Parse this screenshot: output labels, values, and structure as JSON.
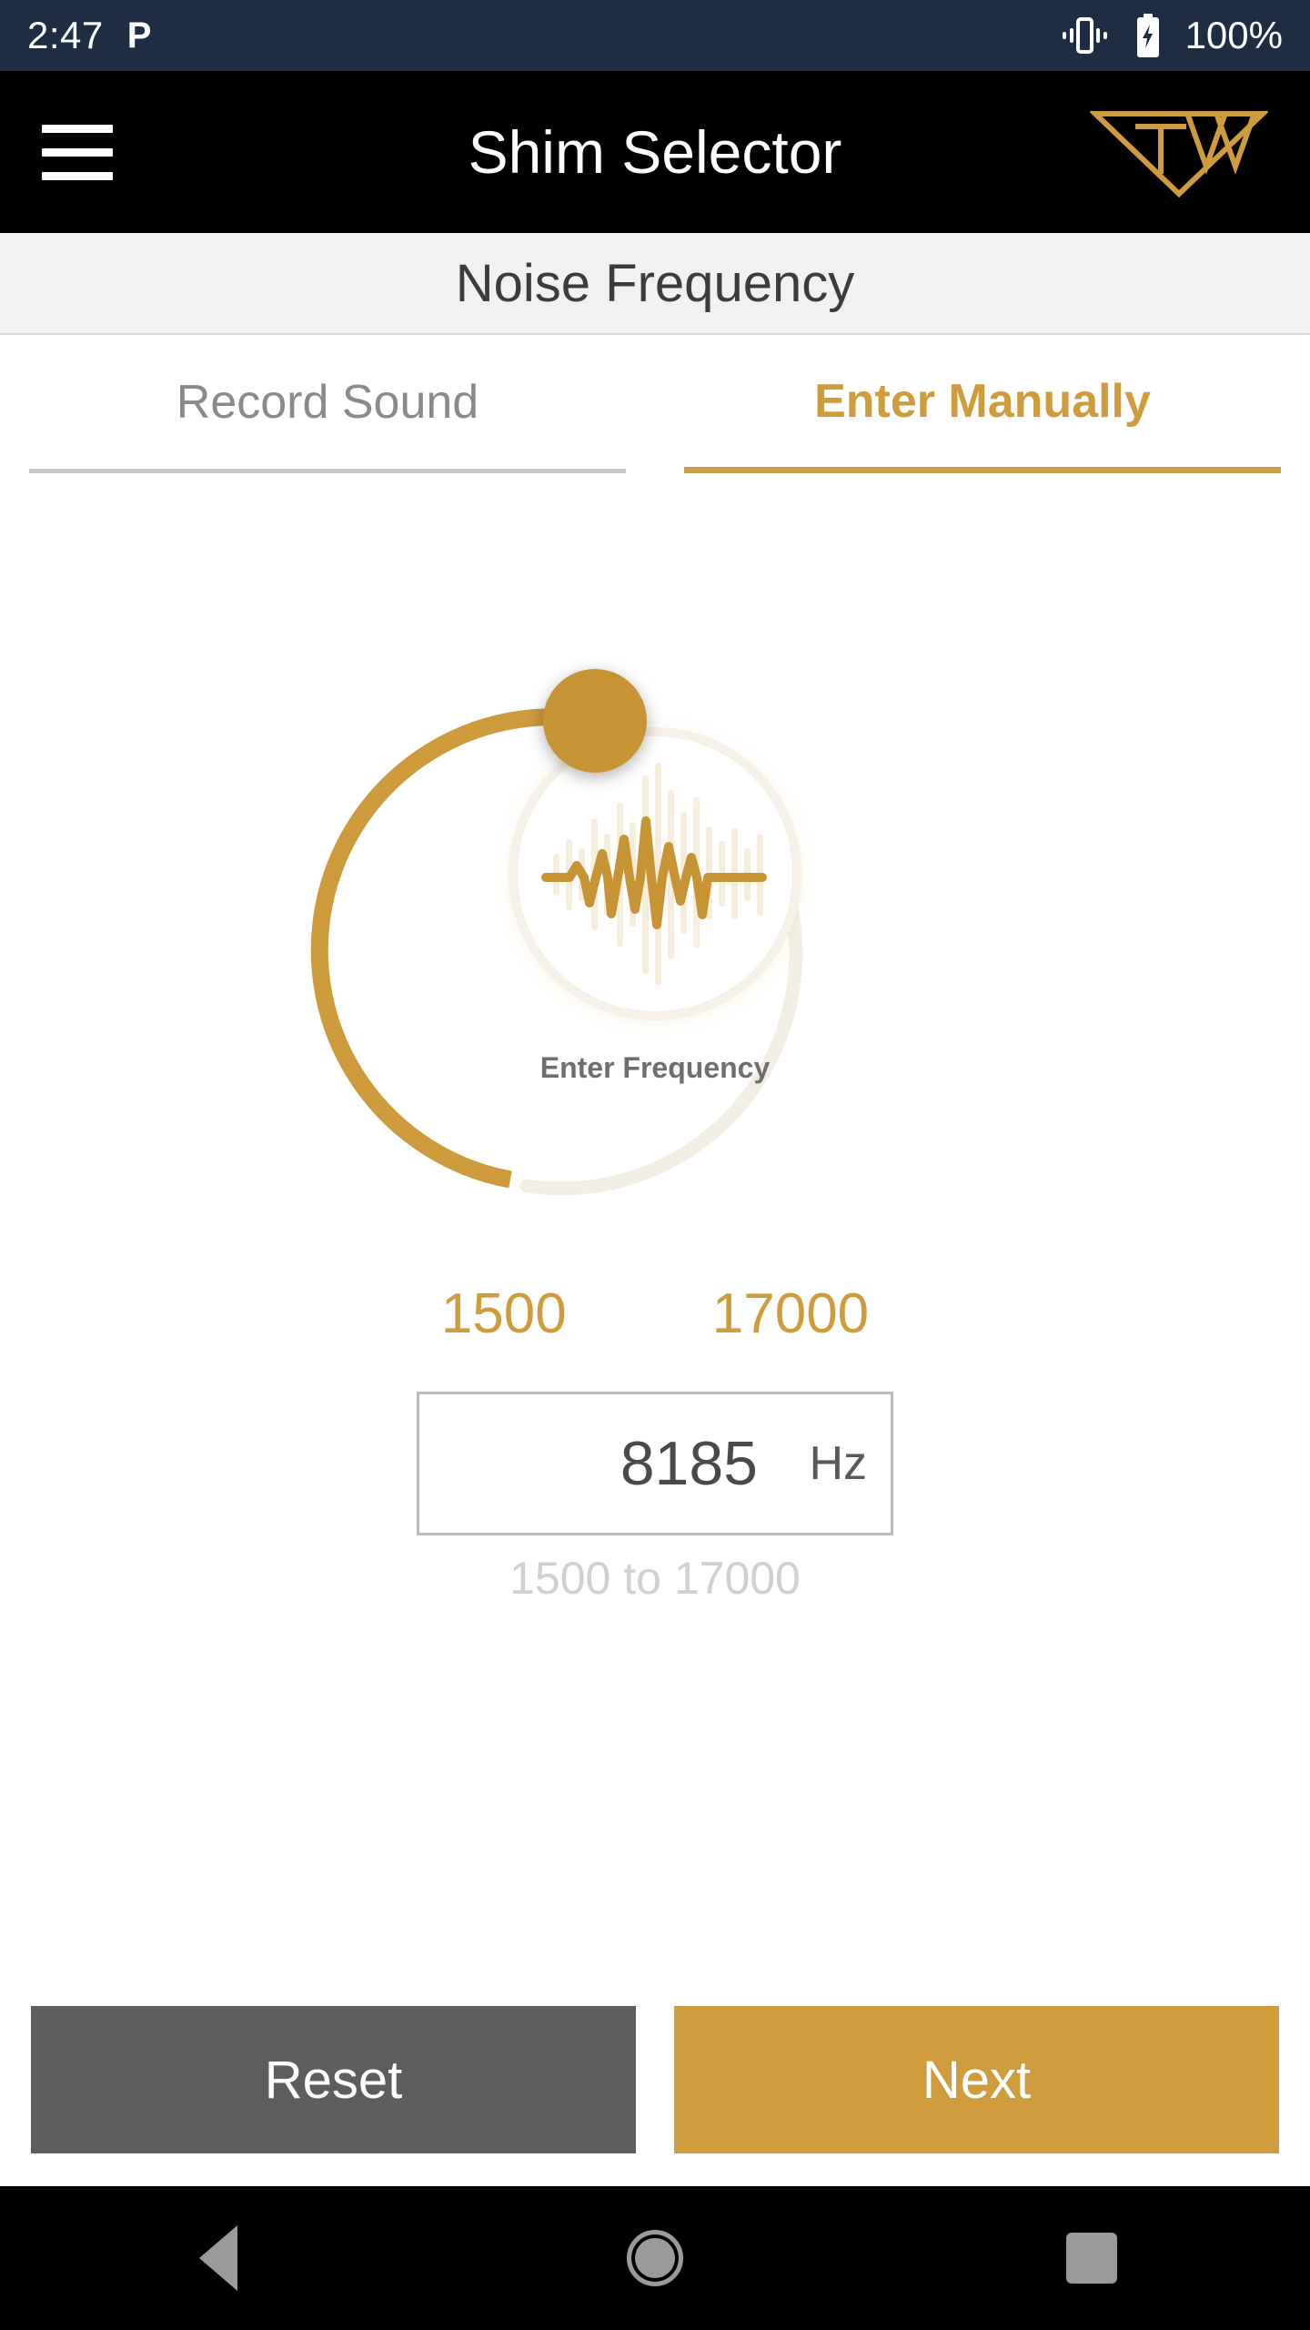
{
  "status_bar": {
    "time": "2:47",
    "notification_icon_label": "P",
    "battery_text": "100%",
    "vibrate_icon": "vibrate-icon",
    "battery_icon": "battery-charging-icon",
    "background_color": "#1E2D44"
  },
  "app_bar": {
    "menu_icon": "hamburger-menu-icon",
    "title": "Shim Selector",
    "logo_label": "TWW",
    "background_color": "#000000",
    "accent_color": "#CE9B3D"
  },
  "section": {
    "title": "Noise Frequency"
  },
  "tabs": [
    {
      "label": "Record Sound",
      "active": false
    },
    {
      "label": "Enter Manually",
      "active": true
    }
  ],
  "dial": {
    "center_label": "Enter Frequency",
    "waveform_icon": "audio-waveform-icon",
    "arc_color": "#CD9A3C",
    "track_color": "#F3EEE5",
    "thumb_color": "#C79435",
    "min": 1500,
    "max": 17000,
    "value": 8185
  },
  "range": {
    "min_label": "1500",
    "max_label": "17000"
  },
  "frequency_input": {
    "value": "8185",
    "unit": "Hz",
    "placeholder": "8185",
    "hint": "1500 to 17000"
  },
  "actions": {
    "reset_label": "Reset",
    "reset_color": "#5E5E5E",
    "next_label": "Next",
    "next_color": "#CE9B3D"
  },
  "nav_bar": {
    "back_icon": "nav-back-icon",
    "home_icon": "nav-home-icon",
    "recents_icon": "nav-recents-icon"
  }
}
